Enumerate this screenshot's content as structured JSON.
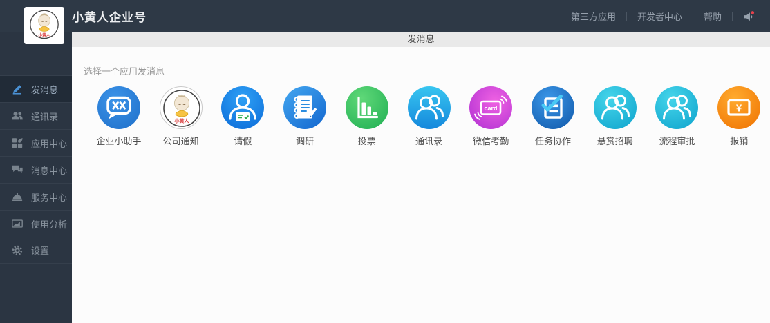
{
  "header": {
    "title": "小黄人企业号",
    "logo_text": "小黄人",
    "nav": [
      {
        "label": "第三方应用"
      },
      {
        "label": "开发者中心"
      },
      {
        "label": "帮助"
      }
    ],
    "notification_icon": "megaphone-icon",
    "notification_dot_color": "#e8414b"
  },
  "sidebar": {
    "items": [
      {
        "label": "发消息",
        "icon": "compose-icon",
        "active": true
      },
      {
        "label": "通讯录",
        "icon": "contacts-icon",
        "active": false
      },
      {
        "label": "应用中心",
        "icon": "app-center-icon",
        "active": false
      },
      {
        "label": "消息中心",
        "icon": "message-center-icon",
        "active": false
      },
      {
        "label": "服务中心",
        "icon": "service-center-icon",
        "active": false
      },
      {
        "label": "使用分析",
        "icon": "analytics-icon",
        "active": false
      },
      {
        "label": "设置",
        "icon": "settings-icon",
        "active": false
      }
    ]
  },
  "main": {
    "subheader_title": "发消息",
    "prompt": "选择一个应用发消息",
    "apps": [
      {
        "label": "企业小助手",
        "icon": "chat-xx-icon",
        "color": "#2b7fd8"
      },
      {
        "label": "公司通知",
        "icon": "minion-avatar-icon",
        "color": "#ffffff",
        "avatar_text": "小黄人"
      },
      {
        "label": "请假",
        "icon": "person-card-icon",
        "color": "#1287e8"
      },
      {
        "label": "调研",
        "icon": "notebook-pencil-icon",
        "color": "#1b7fe0"
      },
      {
        "label": "投票",
        "icon": "bar-chart-icon",
        "color": "#2fbf5f"
      },
      {
        "label": "通讯录",
        "icon": "people-icon",
        "color": "#1fa9e8"
      },
      {
        "label": "微信考勤",
        "icon": "card-icon",
        "color": "#cb3fe0",
        "badge_text": "card"
      },
      {
        "label": "任务协作",
        "icon": "task-check-icon",
        "color": "#1b6fd0"
      },
      {
        "label": "悬赏招聘",
        "icon": "people-icon",
        "color": "#14b4dc"
      },
      {
        "label": "流程审批",
        "icon": "people-icon",
        "color": "#14b4dc"
      },
      {
        "label": "报销",
        "icon": "yuan-card-icon",
        "color": "#f59110",
        "symbol_text": "¥"
      }
    ]
  },
  "colors": {
    "header_bg": "#2e3946",
    "sidebar_bg": "#2b3542",
    "sidebar_active_bg": "#212b37",
    "accent_blue": "#4a90d2",
    "subheader_bg": "#e9e9e9",
    "content_bg": "#fcfcfc"
  }
}
